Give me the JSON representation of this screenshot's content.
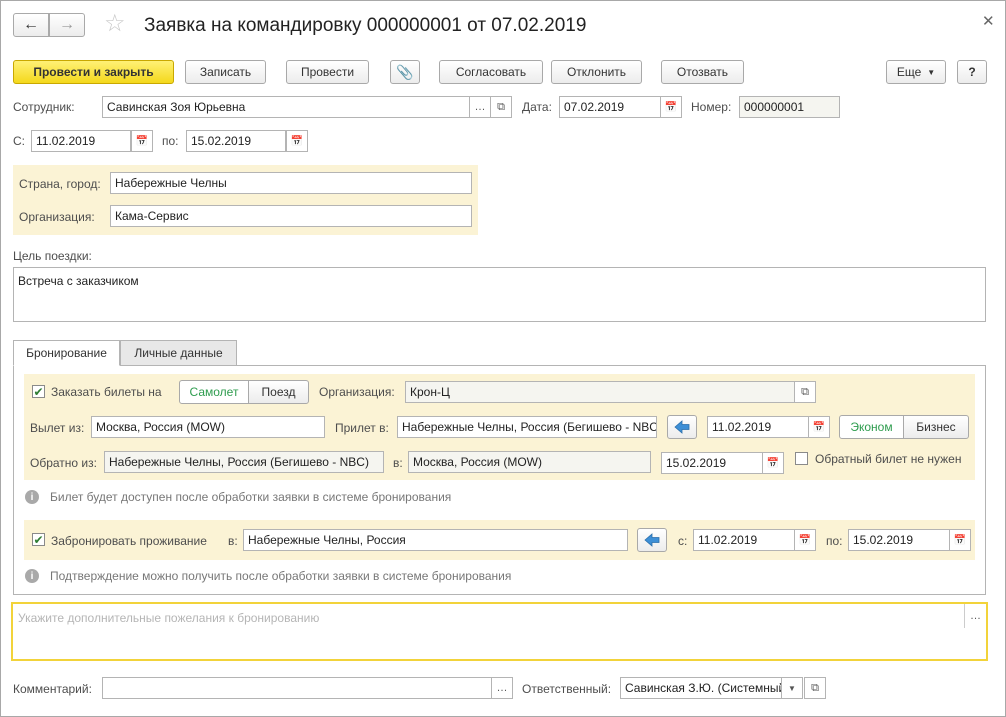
{
  "title": "Заявка на командировку 000000001 от 07.02.2019",
  "toolbar": {
    "post_close": "Провести и закрыть",
    "save": "Записать",
    "post": "Провести",
    "approve": "Согласовать",
    "reject": "Отклонить",
    "revoke": "Отозвать",
    "more": "Еще",
    "help": "?"
  },
  "header": {
    "employee_label": "Сотрудник:",
    "employee_value": "Савинская Зоя Юрьевна",
    "date_label": "Дата:",
    "date_value": "07.02.2019",
    "number_label": "Номер:",
    "number_value": "000000001",
    "from_label": "С:",
    "from_value": "11.02.2019",
    "to_label": "по:",
    "to_value": "15.02.2019"
  },
  "destination": {
    "city_label": "Страна, город:",
    "city_value": "Набережные Челны",
    "org_label": "Организация:",
    "org_value": "Кама-Сервис"
  },
  "purpose": {
    "label": "Цель поездки:",
    "value": "Встреча с заказчиком"
  },
  "tabs": [
    {
      "label": "Бронирование",
      "active": true
    },
    {
      "label": "Личные данные",
      "active": false
    }
  ],
  "booking": {
    "order_tickets_label": "Заказать билеты на",
    "order_tickets_checked": true,
    "transport_plane": "Самолет",
    "transport_train": "Поезд",
    "org_label": "Организация:",
    "org_value": "Крон-Ц",
    "depart_label": "Вылет из:",
    "depart_value": "Москва, Россия (MOW)",
    "arrive_label": "Прилет в:",
    "arrive_value": "Набережные Челны, Россия (Бегишево  - NBC)",
    "depart_date": "11.02.2019",
    "class_economy": "Эконом",
    "class_business": "Бизнес",
    "return_label": "Обратно из:",
    "return_from": "Набережные Челны, Россия (Бегишево  - NBC)",
    "return_to_label": "в:",
    "return_to": "Москва, Россия (MOW)",
    "return_date": "15.02.2019",
    "no_return_label": "Обратный билет не нужен",
    "no_return_checked": false,
    "ticket_info": "Билет будет доступен после обработки заявки в системе бронирования",
    "hotel_label": "Забронировать проживание",
    "hotel_checked": true,
    "hotel_in_label": "в:",
    "hotel_city": "Набережные Челны, Россия",
    "hotel_from_label": "с:",
    "hotel_from": "11.02.2019",
    "hotel_to_label": "по:",
    "hotel_to": "15.02.2019",
    "hotel_info": "Подтверждение можно получить после обработки заявки в системе бронирования",
    "wishes_placeholder": "Укажите дополнительные пожелания к бронированию"
  },
  "footer": {
    "comment_label": "Комментарий:",
    "comment_value": "",
    "responsible_label": "Ответственный:",
    "responsible_value": "Савинская З.Ю. (Системный администратор)"
  },
  "colors": {
    "accent_yellow": "#f4d81c",
    "panel_yellow": "#fbf3d5",
    "active_green": "#2e9c4e",
    "nav_blue": "#3d8fd6"
  }
}
